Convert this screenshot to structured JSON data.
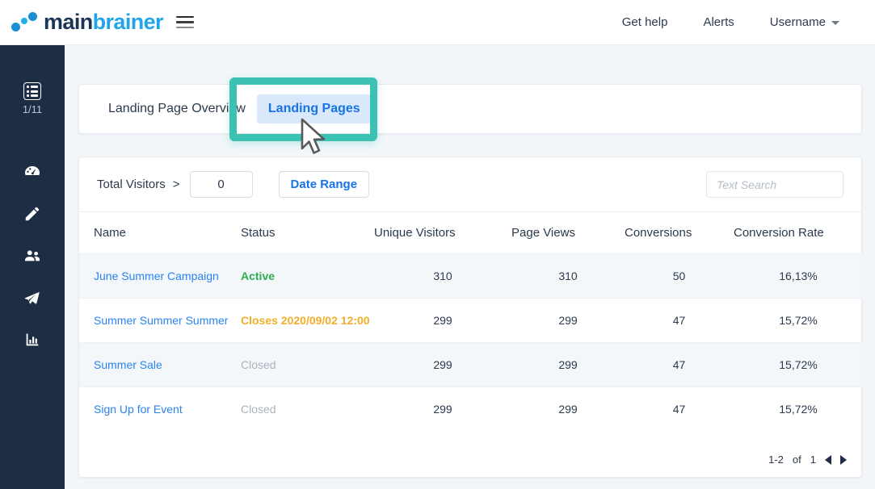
{
  "brand": {
    "name_part1": "main",
    "name_part2": "brainer",
    "menu_icon": "hamburger-icon"
  },
  "topnav": {
    "items": [
      {
        "label": "Get help"
      },
      {
        "label": "Alerts"
      },
      {
        "label": "Username"
      }
    ]
  },
  "sidebar": {
    "counter": "1/11",
    "items": [
      {
        "icon": "list-icon"
      },
      {
        "icon": "dashboard-gauge-icon"
      },
      {
        "icon": "pencil-icon"
      },
      {
        "icon": "users-icon"
      },
      {
        "icon": "paper-plane-icon"
      },
      {
        "icon": "bar-chart-icon"
      }
    ]
  },
  "tabs": [
    {
      "label": "Landing Page Overview",
      "active": false
    },
    {
      "label": "Landing Pages",
      "active": true
    }
  ],
  "filters": {
    "label": "Total Visitors",
    "operator": ">",
    "value": "0",
    "date_range_label": "Date Range",
    "search_placeholder": "Text Search",
    "search_value": ""
  },
  "table": {
    "columns": [
      "Name",
      "Status",
      "Unique Visitors",
      "Page Views",
      "Conversions",
      "Conversion Rate"
    ],
    "rows": [
      {
        "name": "June Summer Campaign",
        "status": "Active",
        "status_kind": "active",
        "unique_visitors": "310",
        "page_views": "310",
        "conversions": "50",
        "conversion_rate": "16,13%"
      },
      {
        "name": "Summer Summer Summer",
        "status": "Closes 2020/09/02 12:00",
        "status_kind": "closes",
        "unique_visitors": "299",
        "page_views": "299",
        "conversions": "47",
        "conversion_rate": "15,72%"
      },
      {
        "name": "Summer Sale",
        "status": "Closed",
        "status_kind": "closed",
        "unique_visitors": "299",
        "page_views": "299",
        "conversions": "47",
        "conversion_rate": "15,72%"
      },
      {
        "name": "Sign Up for Event",
        "status": "Closed",
        "status_kind": "closed",
        "unique_visitors": "299",
        "page_views": "299",
        "conversions": "47",
        "conversion_rate": "15,72%"
      }
    ]
  },
  "pagination": {
    "range": "1-2",
    "of_label": "of",
    "total": "1",
    "prev_icon": "arrow-left-icon",
    "next_icon": "arrow-right-icon"
  },
  "annotation": {
    "highlight_color": "#3cc2b3",
    "target": "Landing Pages",
    "cursor": "mouse-pointer"
  },
  "colors": {
    "accent_blue": "#1673e8",
    "link_blue": "#2a84ed",
    "sidebar_navy": "#1d2d44",
    "status_active": "#2bae52",
    "status_closes": "#f2ad29",
    "status_closed": "#aab3bd",
    "page_bg": "#f2f6f9"
  }
}
